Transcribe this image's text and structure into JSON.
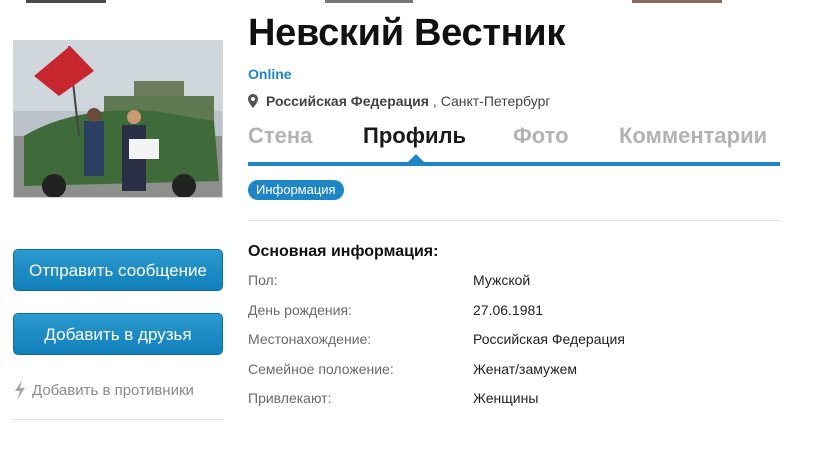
{
  "profile": {
    "name": "Невский Вестник",
    "status": "Online",
    "country": "Российская Федерация",
    "separator": ",",
    "city": "Санкт-Петербург"
  },
  "tabs": {
    "wall": "Стена",
    "profile": "Профиль",
    "photo": "Фото",
    "comments": "Комментарии"
  },
  "subtab": {
    "info": "Информация"
  },
  "actions": {
    "send_message": "Отправить сообщение",
    "add_friend": "Добавить в друзья",
    "add_enemy": "Добавить в противники"
  },
  "info": {
    "title": "Основная информация:",
    "rows": [
      {
        "label": "Пол:",
        "value": "Мужской"
      },
      {
        "label": "День рождения:",
        "value": "27.06.1981"
      },
      {
        "label": "Местонахождение:",
        "value": "Российская Федерация"
      },
      {
        "label": "Семейное положение:",
        "value": "Женат/замужем"
      },
      {
        "label": "Привлекают:",
        "value": "Женщины"
      }
    ]
  },
  "colors": {
    "accent": "#1f86c5",
    "button": "#1784c0"
  },
  "icons": {
    "location": "map-pin-icon",
    "enemy": "lightning-icon"
  }
}
